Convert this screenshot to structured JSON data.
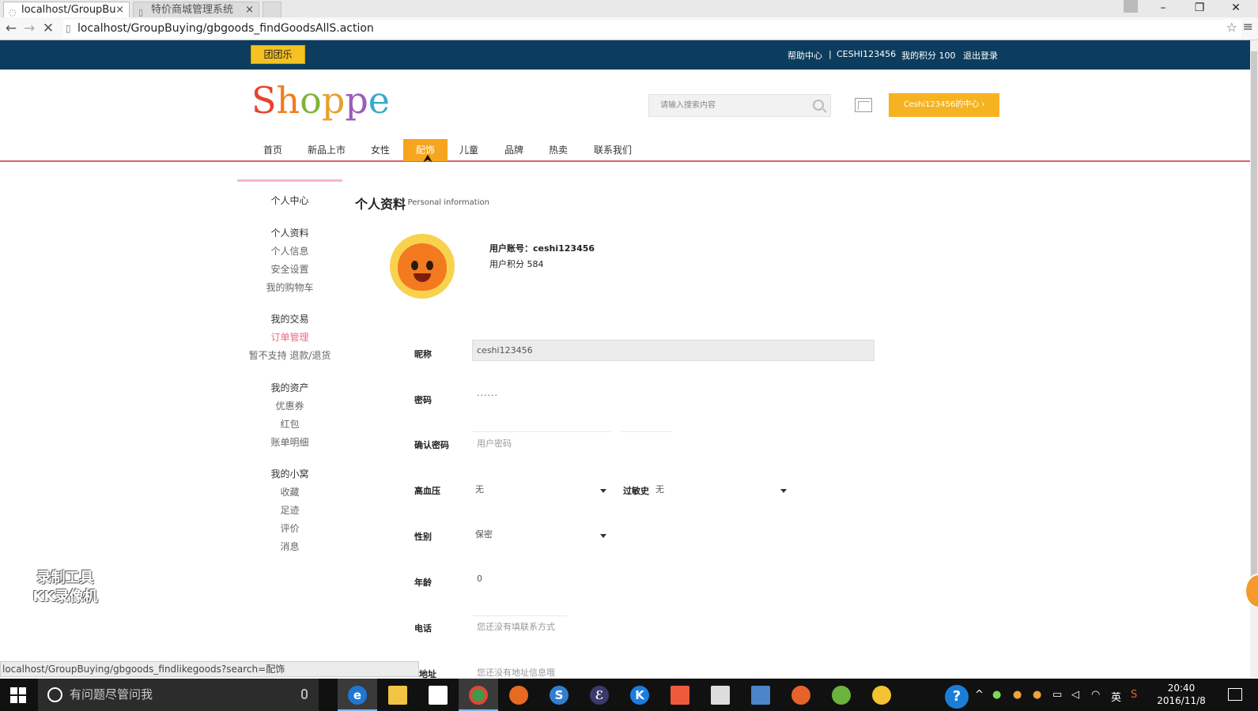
{
  "browser": {
    "tabs": [
      {
        "label": "localhost/GroupBu",
        "active": true
      },
      {
        "label": "特价商城管理系统",
        "active": false
      }
    ],
    "url": "localhost/GroupBuying/gbgoods_findGoodsAllS.action",
    "status_url": "localhost/GroupBuying/gbgoods_findlikegoods?search=配饰"
  },
  "topbar": {
    "brand_button": "团团乐",
    "links": [
      "帮助中心",
      "|",
      "CESHI123456",
      "我的积分 100",
      "退出登录"
    ]
  },
  "header": {
    "logo": [
      "S",
      "h",
      "o",
      "p",
      "p",
      "e"
    ],
    "logo_colors": [
      "#e8432a",
      "#f07d1c",
      "#7fb436",
      "#e5a12f",
      "#9a5cb8",
      "#3aa9c9"
    ],
    "search_placeholder": "请输入搜索内容",
    "user_center_button": "Ceshi123456的中心"
  },
  "nav": {
    "items": [
      "首页",
      "新品上市",
      "女性",
      "配饰",
      "儿童",
      "品牌",
      "热卖",
      "联系我们"
    ],
    "active_index": 3,
    "active_color": "#f6a51f"
  },
  "sidebar": {
    "title": "个人中心",
    "groups": [
      {
        "items": [
          "个人资料",
          "个人信息",
          "安全设置",
          "我的购物车"
        ]
      },
      {
        "items": [
          "我的交易",
          "订单管理",
          "暂不支持 退款/退货"
        ]
      },
      {
        "items": [
          "我的资产",
          "优惠券",
          "红包",
          "账单明细"
        ]
      },
      {
        "items": [
          "我的小窝",
          "收藏",
          "足迹",
          "评价",
          "消息"
        ]
      }
    ],
    "highlight_color": "#ee6c86"
  },
  "profile": {
    "title": "个人资料",
    "subtitle": "/ Personal information",
    "account_label": "用户账号：ceshi123456",
    "points_label": "用户积分 584",
    "fields": {
      "nickname": {
        "label": "昵称",
        "value": "ceshi123456"
      },
      "password": {
        "label": "密码",
        "value": "······"
      },
      "confirm_password": {
        "label": "确认密码",
        "placeholder": "用户密码"
      },
      "hypertension": {
        "label": "高血压",
        "value": "无"
      },
      "allergy": {
        "label": "过敏史",
        "value": "无"
      },
      "gender": {
        "label": "性别",
        "value": "保密"
      },
      "age": {
        "label": "年龄",
        "value": "0"
      },
      "phone": {
        "label": "电话",
        "placeholder": "您还没有填联系方式"
      },
      "address": {
        "label": "地址",
        "placeholder": "您还没有地址信息哦"
      }
    }
  },
  "watermark": {
    "line1": "录制工具",
    "line2": "KK录像机"
  },
  "taskbar": {
    "search_text": "有问题尽管问我",
    "time": "20:40",
    "date": "2016/11/8",
    "ime": "英"
  }
}
